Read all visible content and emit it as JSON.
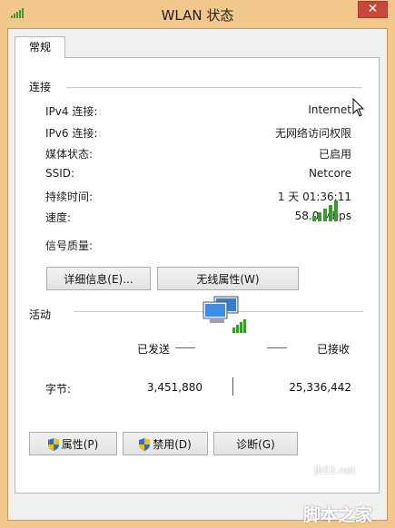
{
  "window": {
    "title": "WLAN 状态",
    "close_label": "✕"
  },
  "tab": {
    "label": "常规"
  },
  "connection": {
    "section_label": "连接",
    "rows": [
      {
        "label": "IPv4 连接:",
        "value": "Internet"
      },
      {
        "label": "IPv6 连接:",
        "value": "无网络访问权限"
      },
      {
        "label": "媒体状态:",
        "value": "已启用"
      },
      {
        "label": "SSID:",
        "value": "Netcore"
      },
      {
        "label": "持续时间:",
        "value": "1 天 01:36:11"
      },
      {
        "label": "速度:",
        "value": "58.0 Mbps"
      }
    ],
    "signal_label": "信号质量:",
    "signal_bars_lit": 5,
    "signal_bars_total": 5,
    "details_button": "详细信息(E)...",
    "wireless_props_button": "无线属性(W)"
  },
  "activity": {
    "section_label": "活动",
    "sent_label": "已发送",
    "received_label": "已接收",
    "bytes_label": "字节:",
    "bytes_sent": "3,451,880",
    "bytes_received": "25,336,442"
  },
  "buttons": {
    "properties": "属性(P)",
    "disable": "禁用(D)",
    "diagnose": "诊断(G)"
  },
  "watermark": {
    "site": "jb51.net",
    "brand": "脚本之家"
  },
  "colors": {
    "titlebar": "#f1c78c",
    "close_button": "#c7473b",
    "signal_green": "#3a9a2e"
  }
}
